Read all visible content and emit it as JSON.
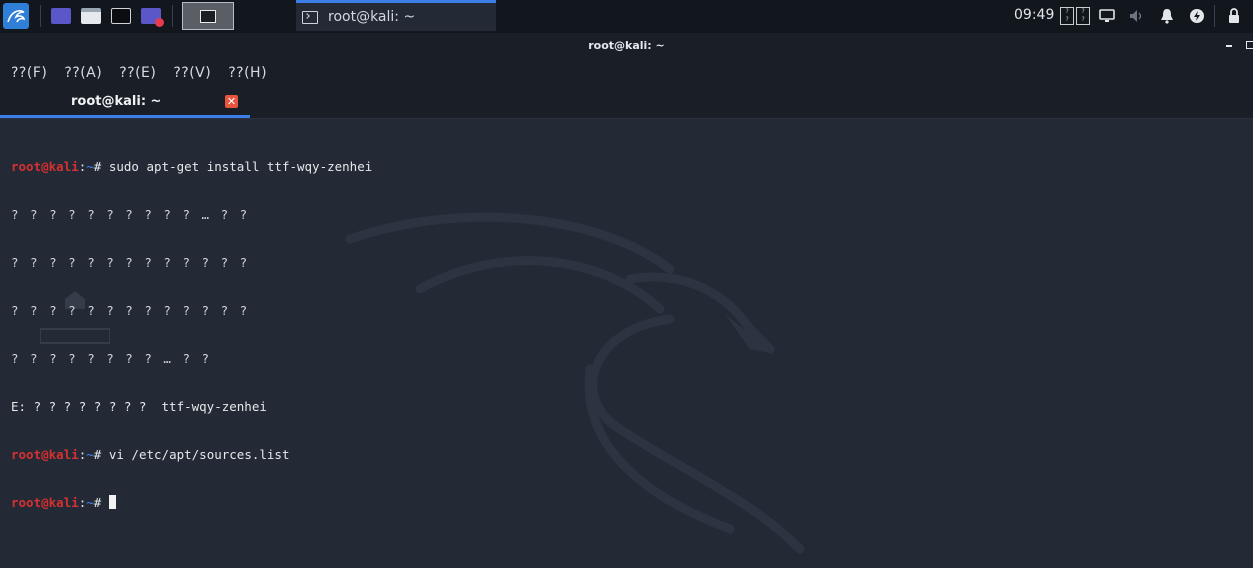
{
  "panel": {
    "clock": "09:49",
    "task_title": "root@kali: ~",
    "lang_glyphs": [
      "?",
      "?",
      "?",
      "?"
    ]
  },
  "window": {
    "title": "root@kali: ~"
  },
  "menubar": {
    "items": [
      "??(F)",
      "??(A)",
      "??(E)",
      "??(V)",
      "??(H)"
    ]
  },
  "tab": {
    "label": "root@kali: ~",
    "close_glyph": "✕"
  },
  "terminal": {
    "prompt_user": "root@kali",
    "prompt_sep": ":",
    "prompt_path": "~",
    "prompt_symbol": "# ",
    "lines": [
      {
        "type": "prompt",
        "command": "sudo apt-get install ttf-wqy-zenhei"
      },
      {
        "type": "output",
        "text": "? ? ? ? ? ? ? ? ? ? … ? ?"
      },
      {
        "type": "output",
        "text": "? ? ? ? ? ? ? ? ? ? ? ? ?"
      },
      {
        "type": "output",
        "text": "? ? ? ? ? ? ? ? ? ? ? ? ?"
      },
      {
        "type": "output",
        "text": "? ? ? ? ? ? ? ? … ? ?"
      },
      {
        "type": "output",
        "text": "E: ? ? ? ? ? ? ? ?  ttf-wqy-zenhei"
      },
      {
        "type": "prompt",
        "command": "vi /etc/apt/sources.list"
      },
      {
        "type": "prompt",
        "command": ""
      }
    ]
  },
  "colors": {
    "accent": "#3b7ee8",
    "prompt_user": "#d63031",
    "prompt_path": "#3f8cf0",
    "terminal_bg": "#232a36"
  }
}
